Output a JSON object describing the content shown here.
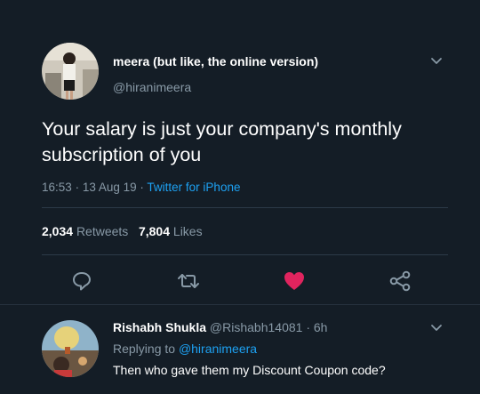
{
  "tweet": {
    "author_name": "meera (but like, the online version)",
    "author_handle": "@hiranimeera",
    "text": "Your salary is just your company's monthly subscription of you",
    "time": "16:53",
    "date": "13 Aug 19",
    "source": "Twitter for iPhone",
    "separator": "·",
    "retweets_count": "2,034",
    "retweets_label": "Retweets",
    "likes_count": "7,804",
    "likes_label": "Likes"
  },
  "actions": {
    "reply_icon": "speech-bubble",
    "retweet_icon": "retweet-arrows",
    "like_icon": "heart",
    "share_icon": "share-nodes",
    "like_color": "#e0245e",
    "icon_color": "#8899a6"
  },
  "reply": {
    "author_name": "Rishabh Shukla",
    "author_handle": "@Rishabh14081",
    "separator": "·",
    "age": "6h",
    "replying_to_label": "Replying to",
    "replying_to_handle": "@hiranimeera",
    "text": "Then who gave them my Discount Coupon code?"
  },
  "colors": {
    "background": "#141d26",
    "text_primary": "#ffffff",
    "text_secondary": "#8899a6",
    "link": "#1da1f2"
  }
}
